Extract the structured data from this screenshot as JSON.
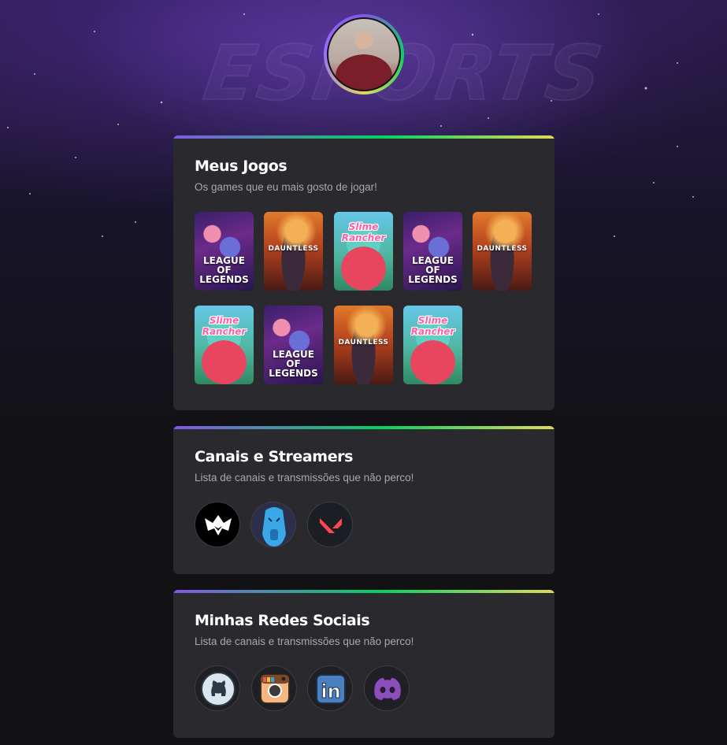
{
  "header": {
    "background_text": "ESPORTS",
    "avatar_alt": "profile-photo"
  },
  "colors": {
    "accent_start": "#8257e5",
    "accent_mid": "#04d361",
    "accent_end": "#e1d95a",
    "card_bg": "#29292e",
    "page_bg": "#121214"
  },
  "games_section": {
    "title": "Meus Jogos",
    "subtitle": "Os games que eu mais gosto de jogar!",
    "games": [
      {
        "name": "League of Legends",
        "label_line1": "LEAGUE OF",
        "label_line2": "LEGENDS"
      },
      {
        "name": "Dauntless",
        "label_line1": "DAUNTLESS",
        "label_line2": ""
      },
      {
        "name": "Slime Rancher",
        "label_line1": "Slime Rancher",
        "label_line2": ""
      },
      {
        "name": "League of Legends",
        "label_line1": "LEAGUE OF",
        "label_line2": "LEGENDS"
      },
      {
        "name": "Dauntless",
        "label_line1": "DAUNTLESS",
        "label_line2": ""
      },
      {
        "name": "Slime Rancher",
        "label_line1": "Slime Rancher",
        "label_line2": ""
      },
      {
        "name": "League of Legends",
        "label_line1": "LEAGUE OF",
        "label_line2": "LEGENDS"
      },
      {
        "name": "Dauntless",
        "label_line1": "DAUNTLESS",
        "label_line2": ""
      },
      {
        "name": "Slime Rancher",
        "label_line1": "Slime Rancher",
        "label_line2": ""
      }
    ]
  },
  "channels_section": {
    "title": "Canais e Streamers",
    "subtitle": "Lista de canais e transmissões que não perco!",
    "channels": [
      {
        "icon": "dauntless-logo-icon"
      },
      {
        "icon": "blue-character-icon"
      },
      {
        "icon": "valorant-logo-icon"
      }
    ]
  },
  "social_section": {
    "title": "Minhas Redes Sociais",
    "subtitle": "Lista de canais e transmissões que não perco!",
    "links": [
      {
        "icon": "github-icon"
      },
      {
        "icon": "instagram-icon"
      },
      {
        "icon": "linkedin-icon",
        "text": "in"
      },
      {
        "icon": "discord-icon"
      }
    ]
  }
}
